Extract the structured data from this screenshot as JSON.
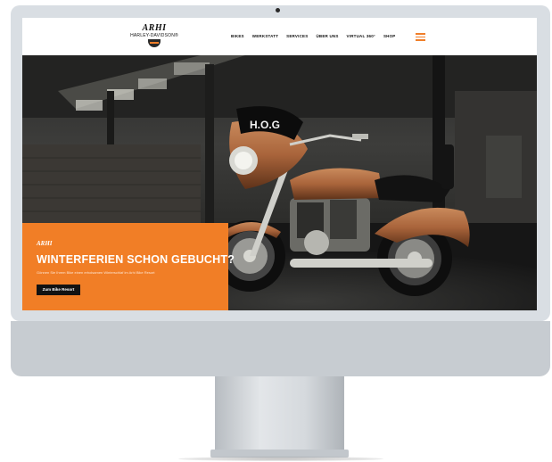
{
  "header": {
    "logo_mark": "ARHI",
    "logo_subtitle": "HARLEY-DAVIDSON®",
    "menu": [
      {
        "label": "BIKES"
      },
      {
        "label": "WERKSTATT"
      },
      {
        "label": "SERVICES"
      },
      {
        "label": "ÜBER UNS"
      },
      {
        "label": "VIRTUAL 360°"
      },
      {
        "label": "SHOP"
      }
    ],
    "menu_icon": "hamburger-icon"
  },
  "hero": {
    "promo_logo": "ARHI",
    "title": "WINTERFERIEN SCHON GEBUCHT?",
    "text": "Gönnen Sie Ihrem Bike einen erholsamen Winterschlaf im Arhi Bike Resort",
    "button_label": "Zum Bike Resort",
    "fairing_text": "H.O.G"
  },
  "colors": {
    "accent": "#f17e26",
    "dark": "#121212",
    "bike_copper": "#a9643b"
  }
}
